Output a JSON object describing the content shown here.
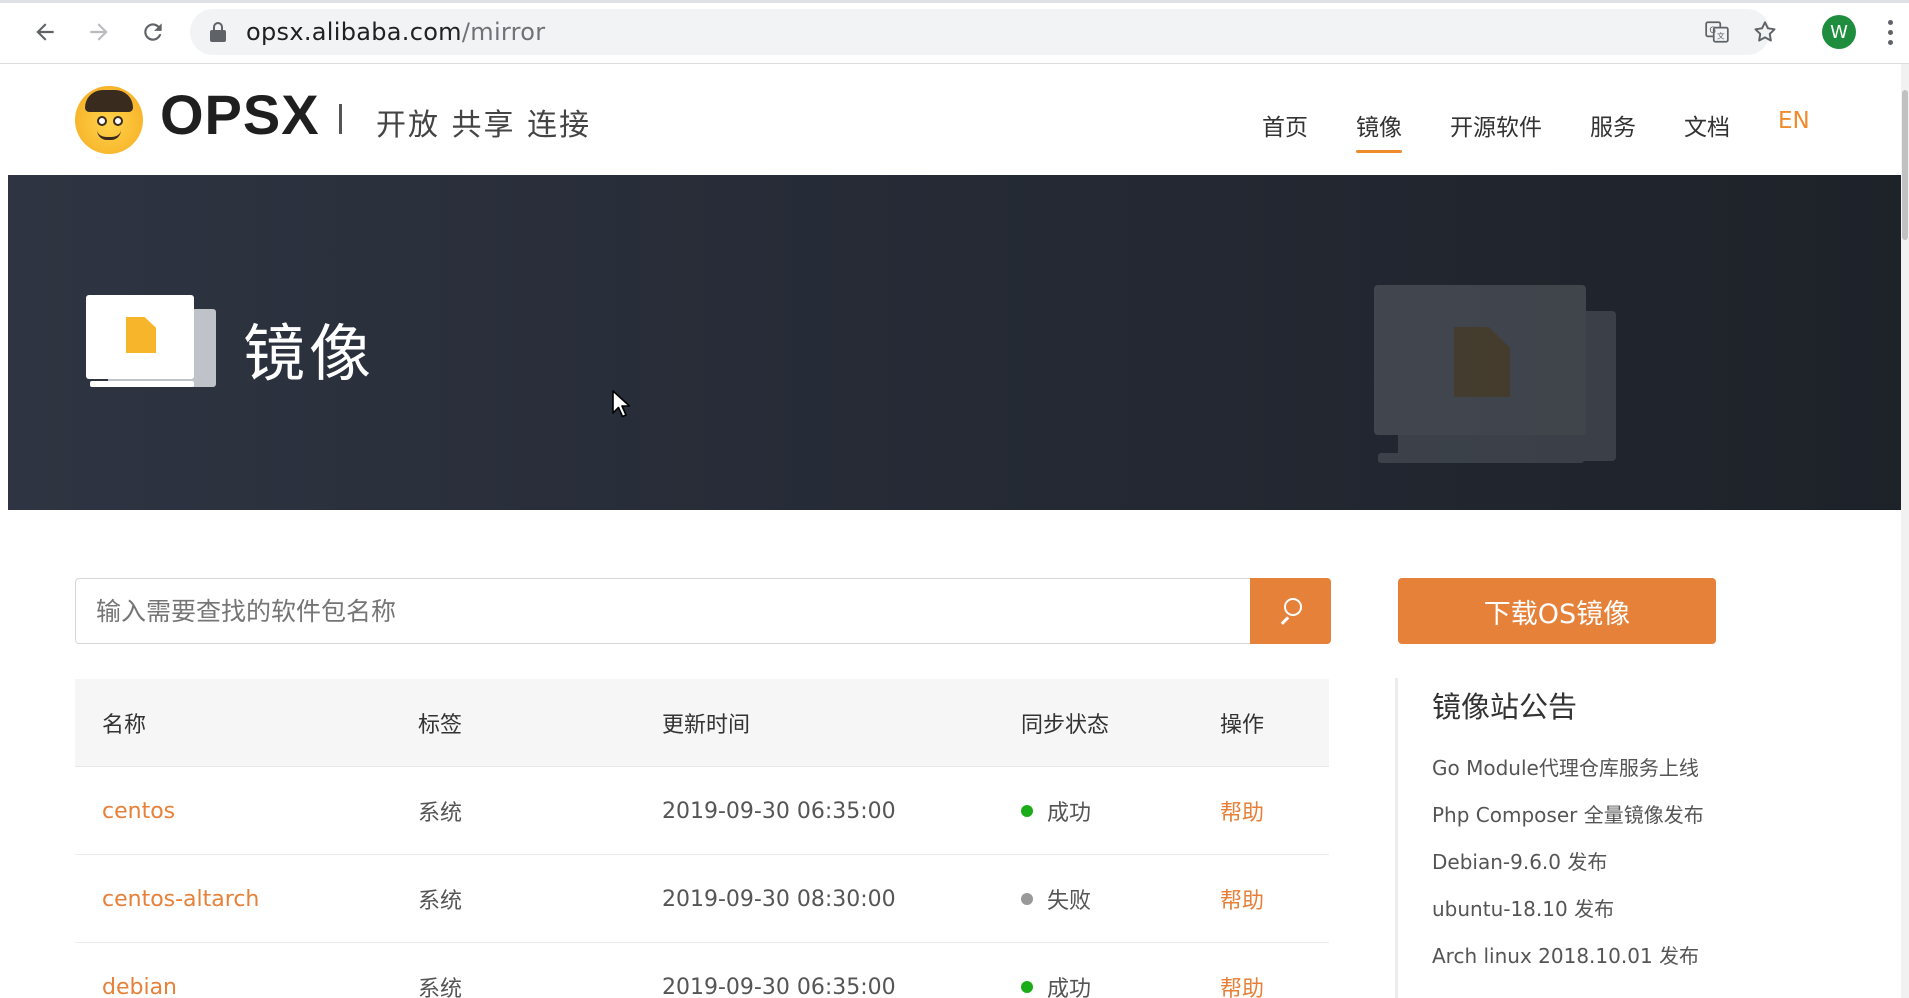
{
  "browser": {
    "url_domain": "opsx.alibaba.com",
    "url_path": "/mirror",
    "back_icon": "arrow-left-icon",
    "forward_icon": "arrow-right-icon",
    "reload_icon": "reload-icon",
    "translate_icon": "translate-icon",
    "star_icon": "star-icon",
    "profile_initial": "W",
    "profile_color": "#1e8e3e"
  },
  "header": {
    "logo_text": "OPSX",
    "slogan": "开放 共享 连接",
    "nav": [
      {
        "label": "首页",
        "active": false
      },
      {
        "label": "镜像",
        "active": true
      },
      {
        "label": "开源软件",
        "active": false
      },
      {
        "label": "服务",
        "active": false
      },
      {
        "label": "文档",
        "active": false
      },
      {
        "label": "EN",
        "active": false
      }
    ],
    "accent_color": "#ef8b2c"
  },
  "banner": {
    "title": "镜像"
  },
  "search": {
    "placeholder": "输入需要查找的软件包名称",
    "button_icon": "search-icon"
  },
  "download_button": "下载OS镜像",
  "table": {
    "headers": [
      "名称",
      "标签",
      "更新时间",
      "同步状态",
      "操作"
    ],
    "rows": [
      {
        "name": "centos",
        "tag": "系统",
        "time": "2019-09-30 06:35:00",
        "status": "成功",
        "status_color": "#1aad19",
        "action": "帮助"
      },
      {
        "name": "centos-altarch",
        "tag": "系统",
        "time": "2019-09-30 08:30:00",
        "status": "失败",
        "status_color": "#999999",
        "action": "帮助"
      },
      {
        "name": "debian",
        "tag": "系统",
        "time": "2019-09-30 06:35:00",
        "status": "成功",
        "status_color": "#1aad19",
        "action": "帮助"
      }
    ]
  },
  "announcements": {
    "title": "镜像站公告",
    "items": [
      "Go Module代理仓库服务上线",
      "Php Composer 全量镜像发布",
      "Debian-9.6.0 发布",
      "ubuntu-18.10 发布",
      "Arch linux 2018.10.01 发布"
    ]
  }
}
